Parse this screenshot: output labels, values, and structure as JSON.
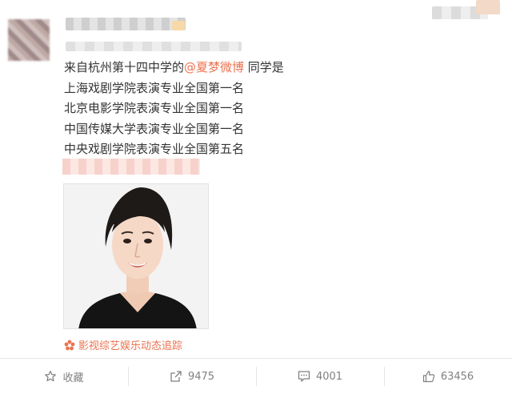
{
  "post": {
    "lines": [
      {
        "pre": "来自杭州第十四中学的",
        "mention": "@夏梦微博",
        "post": " 同学是"
      },
      {
        "text": "上海戏剧学院表演专业全国第一名"
      },
      {
        "text": "北京电影学院表演专业全国第一名"
      },
      {
        "text": "中国传媒大学表演专业全国第一名"
      },
      {
        "text": "中央戏剧学院表演专业全国第五名"
      }
    ],
    "source": "影视综艺娱乐动态追踪"
  },
  "actions": {
    "favorite": "收藏",
    "repost": "9475",
    "comment": "4001",
    "like": "63456"
  },
  "colors": {
    "accent": "#eb7350",
    "muted": "#808080"
  }
}
